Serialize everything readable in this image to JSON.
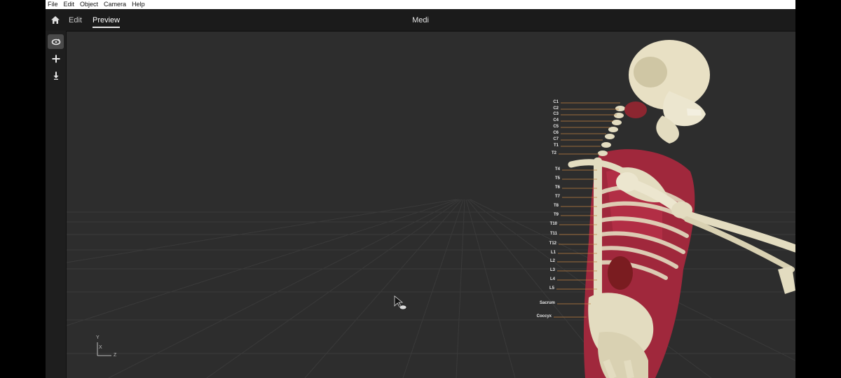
{
  "menu": [
    "File",
    "Edit",
    "Object",
    "Camera",
    "Help"
  ],
  "tabs": {
    "edit": "Edit",
    "preview": "Preview"
  },
  "window_title": "Medi",
  "tools": [
    "orbit-icon",
    "move-icon",
    "drop-icon"
  ],
  "vertebra_labels": [
    "C1",
    "C2",
    "C3",
    "C4",
    "C5",
    "C6",
    "C7",
    "T1",
    "T2",
    "T4",
    "T5",
    "T6",
    "T7",
    "T8",
    "T9",
    "T10",
    "T11",
    "T12",
    "L1",
    "L2",
    "L3",
    "L4",
    "L5",
    "Sacrum",
    "Coccyx"
  ],
  "axes": {
    "y": "Y",
    "x": "X",
    "z": "Z"
  },
  "colors": {
    "viewport_bg": "#2d2d2d",
    "bone": "#e3dcc0",
    "muscle": "#a0283c",
    "label_line": "#c08040"
  }
}
